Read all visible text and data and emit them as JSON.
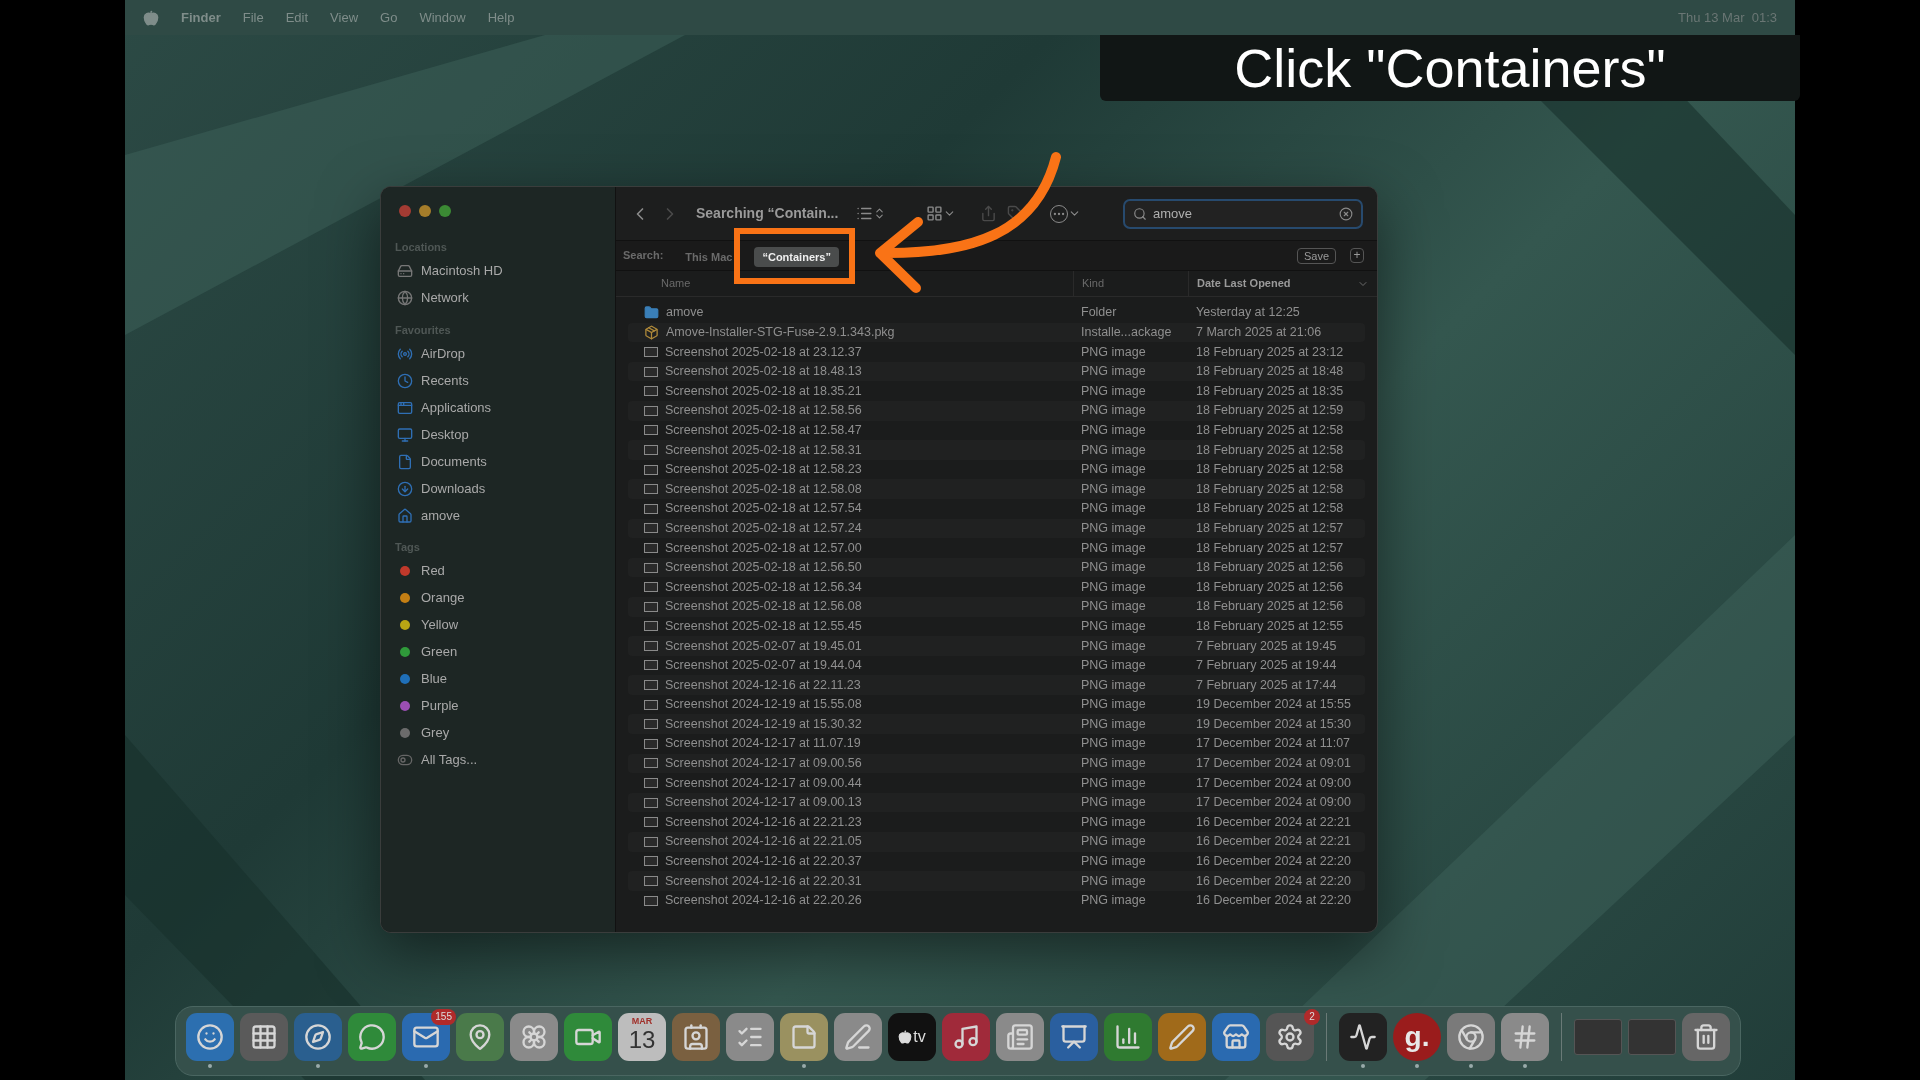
{
  "menu_bar": {
    "items": [
      {
        "label": "Finder",
        "kind": "app"
      },
      {
        "label": "File",
        "kind": "menu"
      },
      {
        "label": "Edit",
        "kind": "menu"
      },
      {
        "label": "View",
        "kind": "menu"
      },
      {
        "label": "Go",
        "kind": "menu"
      },
      {
        "label": "Window",
        "kind": "menu"
      },
      {
        "label": "Help",
        "kind": "menu"
      }
    ],
    "clock": "Thu 13 Mar  01:3"
  },
  "caption": "Click \"Containers\"",
  "finder": {
    "title": "Searching “Contain...",
    "search": {
      "value": "amove"
    },
    "sidebar": [
      {
        "heading": "Locations",
        "items": [
          {
            "label": "Macintosh HD",
            "kind": "disk"
          },
          {
            "label": "Network",
            "kind": "network"
          }
        ]
      },
      {
        "heading": "Favourites",
        "items": [
          {
            "label": "AirDrop",
            "kind": "airdrop"
          },
          {
            "label": "Recents",
            "kind": "recents"
          },
          {
            "label": "Applications",
            "kind": "applications"
          },
          {
            "label": "Desktop",
            "kind": "desktop"
          },
          {
            "label": "Documents",
            "kind": "documents"
          },
          {
            "label": "Downloads",
            "kind": "downloads"
          },
          {
            "label": "amove",
            "kind": "home"
          }
        ]
      },
      {
        "heading": "Tags",
        "items": [
          {
            "label": "Red",
            "kind": "tag",
            "color": "#c0392b"
          },
          {
            "label": "Orange",
            "kind": "tag",
            "color": "#c47f14"
          },
          {
            "label": "Yellow",
            "kind": "tag",
            "color": "#b8a514"
          },
          {
            "label": "Green",
            "kind": "tag",
            "color": "#2f9a3a"
          },
          {
            "label": "Blue",
            "kind": "tag",
            "color": "#1f6fb8"
          },
          {
            "label": "Purple",
            "kind": "tag",
            "color": "#9b4fb3"
          },
          {
            "label": "Grey",
            "kind": "tag",
            "color": "#6b6b6b"
          },
          {
            "label": "All Tags...",
            "kind": "all-tags"
          }
        ]
      }
    ],
    "scope": {
      "label": "Search:",
      "options": [
        {
          "label": "This Mac",
          "selected": false
        },
        {
          "label": "“Containers”",
          "selected": true
        }
      ],
      "save": "Save",
      "add": "+"
    },
    "columns": [
      {
        "label": "Name",
        "sorted": false
      },
      {
        "label": "Kind",
        "sorted": false
      },
      {
        "label": "Date Last Opened",
        "sorted": true
      }
    ],
    "rows": [
      {
        "name": "amove",
        "kind": "folder",
        "type": "Folder",
        "date": "Yesterday at 12:25"
      },
      {
        "name": "Amove-Installer-STG-Fuse-2.9.1.343.pkg",
        "kind": "package",
        "type": "Installe...ackage",
        "date": "7 March 2025 at 21:06"
      },
      {
        "name": "Screenshot 2025-02-18 at 23.12.37",
        "kind": "image",
        "type": "PNG image",
        "date": "18 February 2025 at 23:12"
      },
      {
        "name": "Screenshot 2025-02-18 at 18.48.13",
        "kind": "image",
        "type": "PNG image",
        "date": "18 February 2025 at 18:48"
      },
      {
        "name": "Screenshot 2025-02-18 at 18.35.21",
        "kind": "image",
        "type": "PNG image",
        "date": "18 February 2025 at 18:35"
      },
      {
        "name": "Screenshot 2025-02-18 at 12.58.56",
        "kind": "image",
        "type": "PNG image",
        "date": "18 February 2025 at 12:59"
      },
      {
        "name": "Screenshot 2025-02-18 at 12.58.47",
        "kind": "image",
        "type": "PNG image",
        "date": "18 February 2025 at 12:58"
      },
      {
        "name": "Screenshot 2025-02-18 at 12.58.31",
        "kind": "image",
        "type": "PNG image",
        "date": "18 February 2025 at 12:58"
      },
      {
        "name": "Screenshot 2025-02-18 at 12.58.23",
        "kind": "image",
        "type": "PNG image",
        "date": "18 February 2025 at 12:58"
      },
      {
        "name": "Screenshot 2025-02-18 at 12.58.08",
        "kind": "image",
        "type": "PNG image",
        "date": "18 February 2025 at 12:58"
      },
      {
        "name": "Screenshot 2025-02-18 at 12.57.54",
        "kind": "image",
        "type": "PNG image",
        "date": "18 February 2025 at 12:58"
      },
      {
        "name": "Screenshot 2025-02-18 at 12.57.24",
        "kind": "image",
        "type": "PNG image",
        "date": "18 February 2025 at 12:57"
      },
      {
        "name": "Screenshot 2025-02-18 at 12.57.00",
        "kind": "image",
        "type": "PNG image",
        "date": "18 February 2025 at 12:57"
      },
      {
        "name": "Screenshot 2025-02-18 at 12.56.50",
        "kind": "image",
        "type": "PNG image",
        "date": "18 February 2025 at 12:56"
      },
      {
        "name": "Screenshot 2025-02-18 at 12.56.34",
        "kind": "image",
        "type": "PNG image",
        "date": "18 February 2025 at 12:56"
      },
      {
        "name": "Screenshot 2025-02-18 at 12.56.08",
        "kind": "image",
        "type": "PNG image",
        "date": "18 February 2025 at 12:56"
      },
      {
        "name": "Screenshot 2025-02-18 at 12.55.45",
        "kind": "image",
        "type": "PNG image",
        "date": "18 February 2025 at 12:55"
      },
      {
        "name": "Screenshot 2025-02-07 at 19.45.01",
        "kind": "image",
        "type": "PNG image",
        "date": "7 February 2025 at 19:45"
      },
      {
        "name": "Screenshot 2025-02-07 at 19.44.04",
        "kind": "image",
        "type": "PNG image",
        "date": "7 February 2025 at 19:44"
      },
      {
        "name": "Screenshot 2024-12-16 at 22.11.23",
        "kind": "image",
        "type": "PNG image",
        "date": "7 February 2025 at 17:44"
      },
      {
        "name": "Screenshot 2024-12-19 at 15.55.08",
        "kind": "image",
        "type": "PNG image",
        "date": "19 December 2024 at 15:55"
      },
      {
        "name": "Screenshot 2024-12-19 at 15.30.32",
        "kind": "image",
        "type": "PNG image",
        "date": "19 December 2024 at 15:30"
      },
      {
        "name": "Screenshot 2024-12-17 at 11.07.19",
        "kind": "image",
        "type": "PNG image",
        "date": "17 December 2024 at 11:07"
      },
      {
        "name": "Screenshot 2024-12-17 at 09.00.56",
        "kind": "image",
        "type": "PNG image",
        "date": "17 December 2024 at 09:01"
      },
      {
        "name": "Screenshot 2024-12-17 at 09.00.44",
        "kind": "image",
        "type": "PNG image",
        "date": "17 December 2024 at 09:00"
      },
      {
        "name": "Screenshot 2024-12-17 at 09.00.13",
        "kind": "image",
        "type": "PNG image",
        "date": "17 December 2024 at 09:00"
      },
      {
        "name": "Screenshot 2024-12-16 at 22.21.23",
        "kind": "image",
        "type": "PNG image",
        "date": "16 December 2024 at 22:21"
      },
      {
        "name": "Screenshot 2024-12-16 at 22.21.05",
        "kind": "image",
        "type": "PNG image",
        "date": "16 December 2024 at 22:21"
      },
      {
        "name": "Screenshot 2024-12-16 at 22.20.37",
        "kind": "image",
        "type": "PNG image",
        "date": "16 December 2024 at 22:20"
      },
      {
        "name": "Screenshot 2024-12-16 at 22.20.31",
        "kind": "image",
        "type": "PNG image",
        "date": "16 December 2024 at 22:20"
      },
      {
        "name": "Screenshot 2024-12-16 at 22.20.26",
        "kind": "image",
        "type": "PNG image",
        "date": "16 December 2024 at 22:20"
      }
    ]
  },
  "dock": [
    {
      "kind": "finder",
      "running": true
    },
    {
      "kind": "launchpad",
      "running": false
    },
    {
      "kind": "safari",
      "running": true
    },
    {
      "kind": "messages",
      "running": false
    },
    {
      "kind": "mail",
      "running": true,
      "badge": "155"
    },
    {
      "kind": "maps",
      "running": false
    },
    {
      "kind": "photos",
      "running": false
    },
    {
      "kind": "facetime",
      "running": false
    },
    {
      "kind": "calendar",
      "running": false,
      "month": "MAR",
      "day": "13"
    },
    {
      "kind": "contacts",
      "running": false
    },
    {
      "kind": "reminders",
      "running": false
    },
    {
      "kind": "notes",
      "running": true
    },
    {
      "kind": "freeform",
      "running": false
    },
    {
      "kind": "tv",
      "running": false,
      "text": "tv"
    },
    {
      "kind": "music",
      "running": false
    },
    {
      "kind": "news",
      "running": false
    },
    {
      "kind": "keynote",
      "running": false
    },
    {
      "kind": "numbers",
      "running": false
    },
    {
      "kind": "pages",
      "running": false
    },
    {
      "kind": "appstore",
      "running": false
    },
    {
      "kind": "settings",
      "running": false,
      "badge": "2"
    },
    {
      "kind": "separator"
    },
    {
      "kind": "activity",
      "running": true
    },
    {
      "kind": "g",
      "running": true,
      "text": "g."
    },
    {
      "kind": "chrome",
      "running": true
    },
    {
      "kind": "slack",
      "running": true
    },
    {
      "kind": "separator"
    },
    {
      "kind": "window",
      "running": false
    },
    {
      "kind": "window",
      "running": false
    },
    {
      "kind": "trash",
      "running": false
    }
  ]
}
